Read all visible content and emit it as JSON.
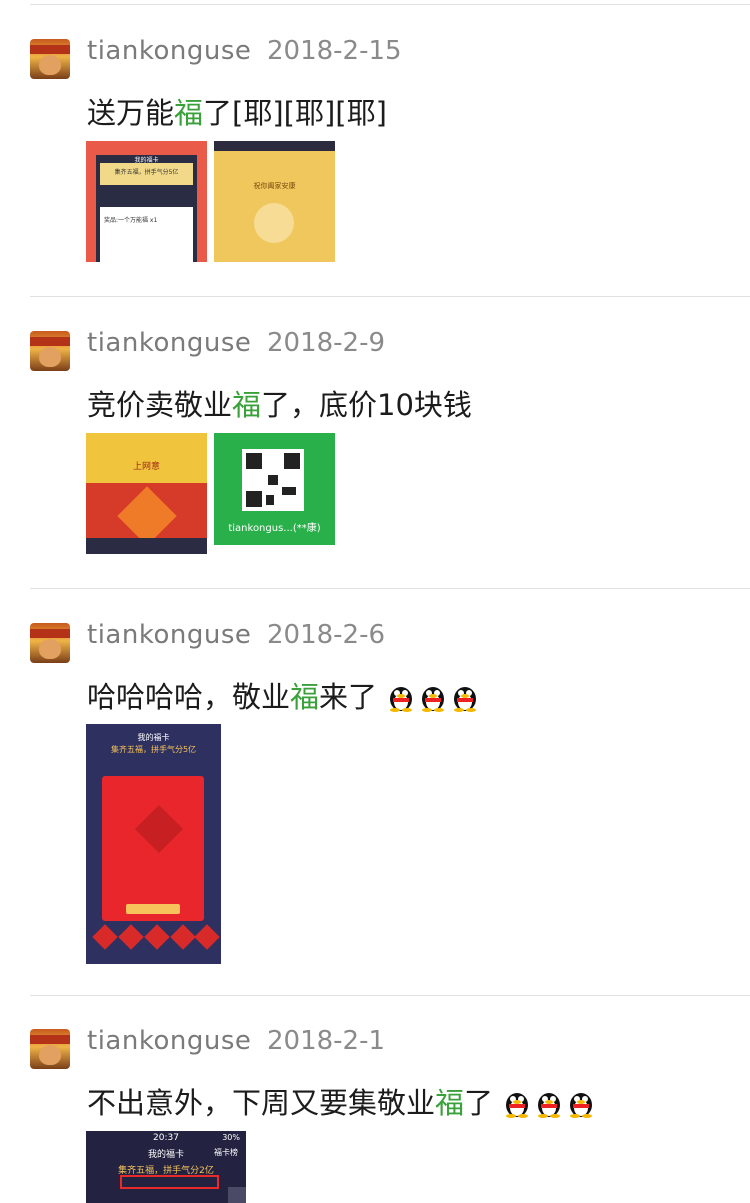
{
  "posts": [
    {
      "user": "tiankonguse",
      "date": "2018-2-15",
      "text_before": "送万能",
      "highlight": "福",
      "text_after": "了[耶][耶][耶]",
      "thumbs": [
        "red-card-screenshot",
        "gold-envelope-screenshot"
      ],
      "thumb_texts": [
        "我的福卡",
        "集齐五福，拼手气分5亿",
        "奖品:一个万能福 x1",
        "祝你阖家安康"
      ]
    },
    {
      "user": "tiankonguse",
      "date": "2018-2-9",
      "text_before": "竞价卖敬业",
      "highlight": "福",
      "text_after": "了，底价10块钱",
      "thumbs": [
        "festival-poster",
        "wechat-qr-code"
      ],
      "thumb_texts": [
        "上网意",
        "tiankongus...(**康)"
      ]
    },
    {
      "user": "tiankonguse",
      "date": "2018-2-6",
      "text_before": "哈哈哈哈，敬业",
      "highlight": "福",
      "text_after": "来了",
      "emoji_count": 3,
      "thumbs": [
        "fu-card-screenshot"
      ],
      "thumb_texts": [
        "我的福卡",
        "集齐五福，拼手气分5亿"
      ]
    },
    {
      "user": "tiankonguse",
      "date": "2018-2-1",
      "text_before": "不出意外，下周又要集敬业",
      "highlight": "福",
      "text_after": "了",
      "emoji_count": 3,
      "thumbs": [
        "fu-card-screenshot-partial"
      ],
      "thumb_texts": [
        "20:37",
        "我的福卡",
        "福卡榜",
        "集齐五福，拼手气分2亿",
        "30%"
      ]
    }
  ],
  "colors": {
    "highlight": "#3aa13a",
    "meta": "#8a8a8a",
    "divider": "#e2e2e2"
  }
}
